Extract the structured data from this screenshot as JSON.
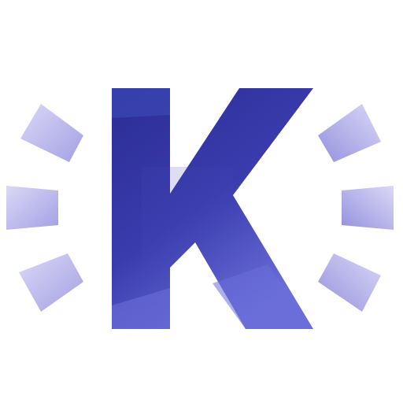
{
  "logo": {
    "letter": "K",
    "colors": {
      "dark": "#2E2F99",
      "mid": "#3D3FB0",
      "light": "#6B6FD6",
      "ray": "#A8A6E8",
      "ray_light": "#D6D3F5"
    }
  }
}
